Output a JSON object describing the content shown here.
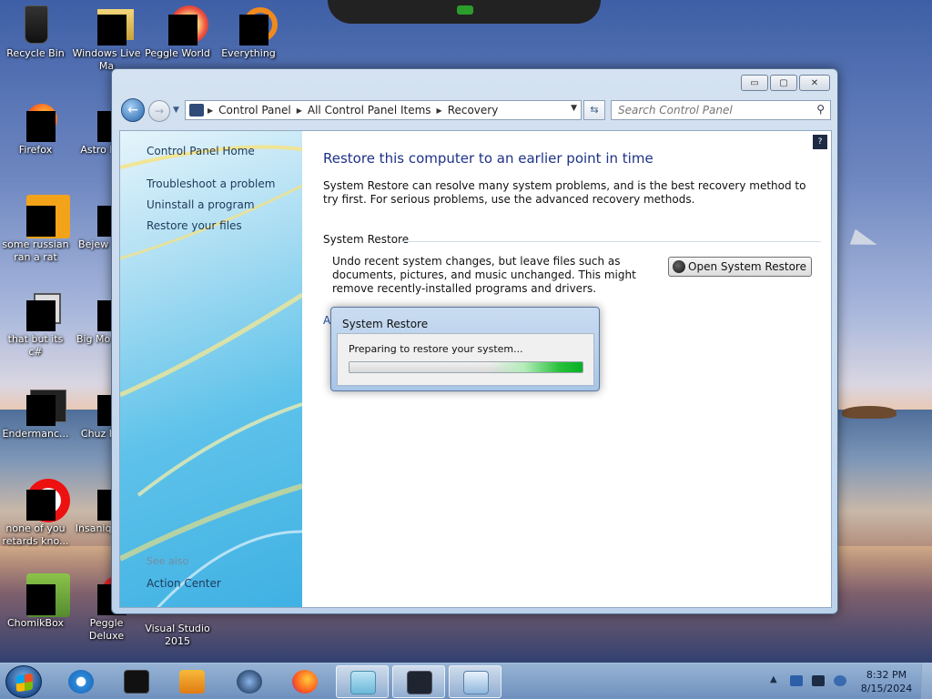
{
  "desktop": {
    "icons": [
      {
        "label": "Recycle Bin"
      },
      {
        "label": "Windows Live Ma"
      },
      {
        "label": "Peggle World"
      },
      {
        "label": "Everything"
      },
      {
        "label": "Firefox"
      },
      {
        "label": "Astro Delu"
      },
      {
        "label": "some russian ran a rat"
      },
      {
        "label": "Bejew Delu"
      },
      {
        "label": "that but its c#"
      },
      {
        "label": "Big Mo Delu"
      },
      {
        "label": "Endermanc..."
      },
      {
        "label": "Chuz Delu"
      },
      {
        "label": "none of you retards kno..."
      },
      {
        "label": "Insaniq Delu"
      },
      {
        "label": "ChomikBox"
      },
      {
        "label": "Peggle Deluxe"
      },
      {
        "label": "Visual Studio 2015"
      }
    ]
  },
  "window": {
    "controls": {
      "minimize": "▭",
      "maximize": "▢",
      "close": "✕"
    },
    "address": {
      "crumbs": [
        "Control Panel",
        "All Control Panel Items",
        "Recovery"
      ]
    },
    "search": {
      "placeholder": "Search Control Panel"
    },
    "sidebar": {
      "home": "Control Panel Home",
      "links": [
        "Troubleshoot a problem",
        "Uninstall a program",
        "Restore your files"
      ],
      "see_also": "See also",
      "action_center": "Action Center"
    },
    "main": {
      "title": "Restore this computer to an earlier point in time",
      "description": "System Restore can resolve many system problems, and is the best recovery method to try first. For serious problems, use the advanced recovery methods.",
      "section_title": "System Restore",
      "section_desc": "Undo recent system changes, but leave files such as documents, pictures, and music unchanged. This might remove recently-installed programs and drivers.",
      "open_button": "Open System Restore",
      "advanced_link": "A"
    }
  },
  "dialog": {
    "title": "System Restore",
    "message": "Preparing to restore your system...",
    "progress": "indeterminate"
  },
  "taskbar": {
    "time": "8:32 PM",
    "date": "8/15/2024",
    "tray_arrow": "▲"
  },
  "colors": {
    "title_blue": "#1e3287",
    "progress_green": "#06b025"
  }
}
